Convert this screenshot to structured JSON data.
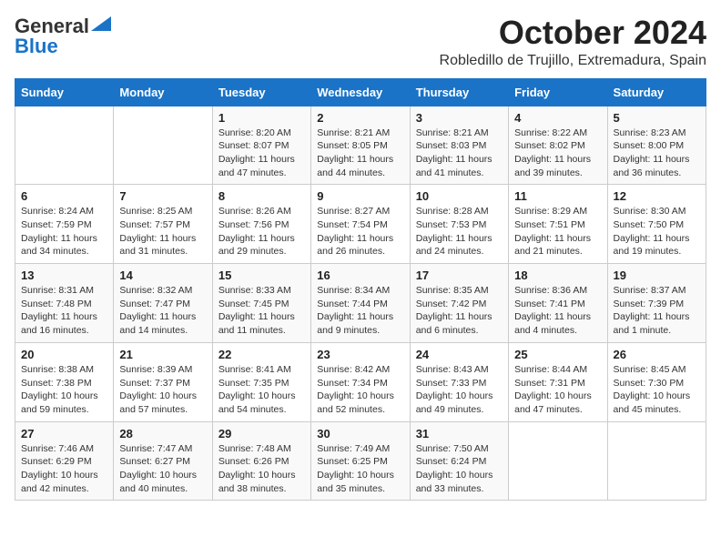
{
  "header": {
    "logo_general": "General",
    "logo_blue": "Blue",
    "month_title": "October 2024",
    "subtitle": "Robledillo de Trujillo, Extremadura, Spain"
  },
  "weekdays": [
    "Sunday",
    "Monday",
    "Tuesday",
    "Wednesday",
    "Thursday",
    "Friday",
    "Saturday"
  ],
  "weeks": [
    [
      {
        "day": "",
        "sunrise": "",
        "sunset": "",
        "daylight": ""
      },
      {
        "day": "",
        "sunrise": "",
        "sunset": "",
        "daylight": ""
      },
      {
        "day": "1",
        "sunrise": "Sunrise: 8:20 AM",
        "sunset": "Sunset: 8:07 PM",
        "daylight": "Daylight: 11 hours and 47 minutes."
      },
      {
        "day": "2",
        "sunrise": "Sunrise: 8:21 AM",
        "sunset": "Sunset: 8:05 PM",
        "daylight": "Daylight: 11 hours and 44 minutes."
      },
      {
        "day": "3",
        "sunrise": "Sunrise: 8:21 AM",
        "sunset": "Sunset: 8:03 PM",
        "daylight": "Daylight: 11 hours and 41 minutes."
      },
      {
        "day": "4",
        "sunrise": "Sunrise: 8:22 AM",
        "sunset": "Sunset: 8:02 PM",
        "daylight": "Daylight: 11 hours and 39 minutes."
      },
      {
        "day": "5",
        "sunrise": "Sunrise: 8:23 AM",
        "sunset": "Sunset: 8:00 PM",
        "daylight": "Daylight: 11 hours and 36 minutes."
      }
    ],
    [
      {
        "day": "6",
        "sunrise": "Sunrise: 8:24 AM",
        "sunset": "Sunset: 7:59 PM",
        "daylight": "Daylight: 11 hours and 34 minutes."
      },
      {
        "day": "7",
        "sunrise": "Sunrise: 8:25 AM",
        "sunset": "Sunset: 7:57 PM",
        "daylight": "Daylight: 11 hours and 31 minutes."
      },
      {
        "day": "8",
        "sunrise": "Sunrise: 8:26 AM",
        "sunset": "Sunset: 7:56 PM",
        "daylight": "Daylight: 11 hours and 29 minutes."
      },
      {
        "day": "9",
        "sunrise": "Sunrise: 8:27 AM",
        "sunset": "Sunset: 7:54 PM",
        "daylight": "Daylight: 11 hours and 26 minutes."
      },
      {
        "day": "10",
        "sunrise": "Sunrise: 8:28 AM",
        "sunset": "Sunset: 7:53 PM",
        "daylight": "Daylight: 11 hours and 24 minutes."
      },
      {
        "day": "11",
        "sunrise": "Sunrise: 8:29 AM",
        "sunset": "Sunset: 7:51 PM",
        "daylight": "Daylight: 11 hours and 21 minutes."
      },
      {
        "day": "12",
        "sunrise": "Sunrise: 8:30 AM",
        "sunset": "Sunset: 7:50 PM",
        "daylight": "Daylight: 11 hours and 19 minutes."
      }
    ],
    [
      {
        "day": "13",
        "sunrise": "Sunrise: 8:31 AM",
        "sunset": "Sunset: 7:48 PM",
        "daylight": "Daylight: 11 hours and 16 minutes."
      },
      {
        "day": "14",
        "sunrise": "Sunrise: 8:32 AM",
        "sunset": "Sunset: 7:47 PM",
        "daylight": "Daylight: 11 hours and 14 minutes."
      },
      {
        "day": "15",
        "sunrise": "Sunrise: 8:33 AM",
        "sunset": "Sunset: 7:45 PM",
        "daylight": "Daylight: 11 hours and 11 minutes."
      },
      {
        "day": "16",
        "sunrise": "Sunrise: 8:34 AM",
        "sunset": "Sunset: 7:44 PM",
        "daylight": "Daylight: 11 hours and 9 minutes."
      },
      {
        "day": "17",
        "sunrise": "Sunrise: 8:35 AM",
        "sunset": "Sunset: 7:42 PM",
        "daylight": "Daylight: 11 hours and 6 minutes."
      },
      {
        "day": "18",
        "sunrise": "Sunrise: 8:36 AM",
        "sunset": "Sunset: 7:41 PM",
        "daylight": "Daylight: 11 hours and 4 minutes."
      },
      {
        "day": "19",
        "sunrise": "Sunrise: 8:37 AM",
        "sunset": "Sunset: 7:39 PM",
        "daylight": "Daylight: 11 hours and 1 minute."
      }
    ],
    [
      {
        "day": "20",
        "sunrise": "Sunrise: 8:38 AM",
        "sunset": "Sunset: 7:38 PM",
        "daylight": "Daylight: 10 hours and 59 minutes."
      },
      {
        "day": "21",
        "sunrise": "Sunrise: 8:39 AM",
        "sunset": "Sunset: 7:37 PM",
        "daylight": "Daylight: 10 hours and 57 minutes."
      },
      {
        "day": "22",
        "sunrise": "Sunrise: 8:41 AM",
        "sunset": "Sunset: 7:35 PM",
        "daylight": "Daylight: 10 hours and 54 minutes."
      },
      {
        "day": "23",
        "sunrise": "Sunrise: 8:42 AM",
        "sunset": "Sunset: 7:34 PM",
        "daylight": "Daylight: 10 hours and 52 minutes."
      },
      {
        "day": "24",
        "sunrise": "Sunrise: 8:43 AM",
        "sunset": "Sunset: 7:33 PM",
        "daylight": "Daylight: 10 hours and 49 minutes."
      },
      {
        "day": "25",
        "sunrise": "Sunrise: 8:44 AM",
        "sunset": "Sunset: 7:31 PM",
        "daylight": "Daylight: 10 hours and 47 minutes."
      },
      {
        "day": "26",
        "sunrise": "Sunrise: 8:45 AM",
        "sunset": "Sunset: 7:30 PM",
        "daylight": "Daylight: 10 hours and 45 minutes."
      }
    ],
    [
      {
        "day": "27",
        "sunrise": "Sunrise: 7:46 AM",
        "sunset": "Sunset: 6:29 PM",
        "daylight": "Daylight: 10 hours and 42 minutes."
      },
      {
        "day": "28",
        "sunrise": "Sunrise: 7:47 AM",
        "sunset": "Sunset: 6:27 PM",
        "daylight": "Daylight: 10 hours and 40 minutes."
      },
      {
        "day": "29",
        "sunrise": "Sunrise: 7:48 AM",
        "sunset": "Sunset: 6:26 PM",
        "daylight": "Daylight: 10 hours and 38 minutes."
      },
      {
        "day": "30",
        "sunrise": "Sunrise: 7:49 AM",
        "sunset": "Sunset: 6:25 PM",
        "daylight": "Daylight: 10 hours and 35 minutes."
      },
      {
        "day": "31",
        "sunrise": "Sunrise: 7:50 AM",
        "sunset": "Sunset: 6:24 PM",
        "daylight": "Daylight: 10 hours and 33 minutes."
      },
      {
        "day": "",
        "sunrise": "",
        "sunset": "",
        "daylight": ""
      },
      {
        "day": "",
        "sunrise": "",
        "sunset": "",
        "daylight": ""
      }
    ]
  ]
}
